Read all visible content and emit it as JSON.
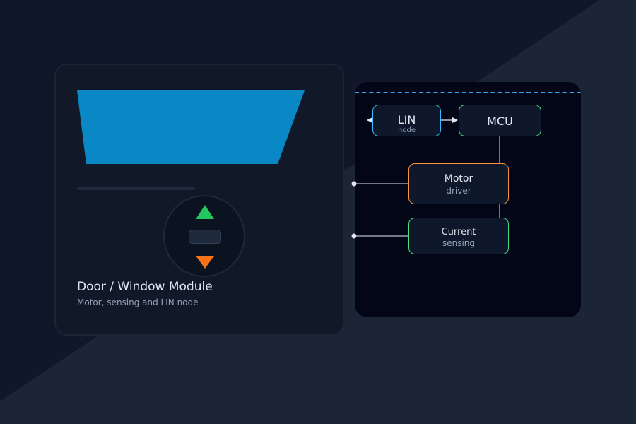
{
  "colors": {
    "background": "#0f1729",
    "background_diagonal": "#1b2536",
    "card": "#111827",
    "diagram_panel": "#020617",
    "glass": "#0a88c6",
    "bus": "#3b9eea",
    "lin_border": "#38bdf8",
    "mcu_border": "#4ade80",
    "motor_border": "#fb923c",
    "current_border": "#4ade80",
    "up_arrow": "#22c55e",
    "down_arrow": "#f97316"
  },
  "module": {
    "title": "Door / Window Module",
    "subtitle": "Motor, sensing and LIN node",
    "switch_center": "— —",
    "icons": [
      "window-glass",
      "up-arrow-icon",
      "down-arrow-icon"
    ]
  },
  "diagram": {
    "blocks": {
      "lin": {
        "label": "LIN",
        "sub": "node"
      },
      "mcu": {
        "label": "MCU"
      },
      "motor": {
        "label": "Motor",
        "sub": "driver"
      },
      "current": {
        "label": "Current",
        "sub": "sensing"
      }
    }
  }
}
